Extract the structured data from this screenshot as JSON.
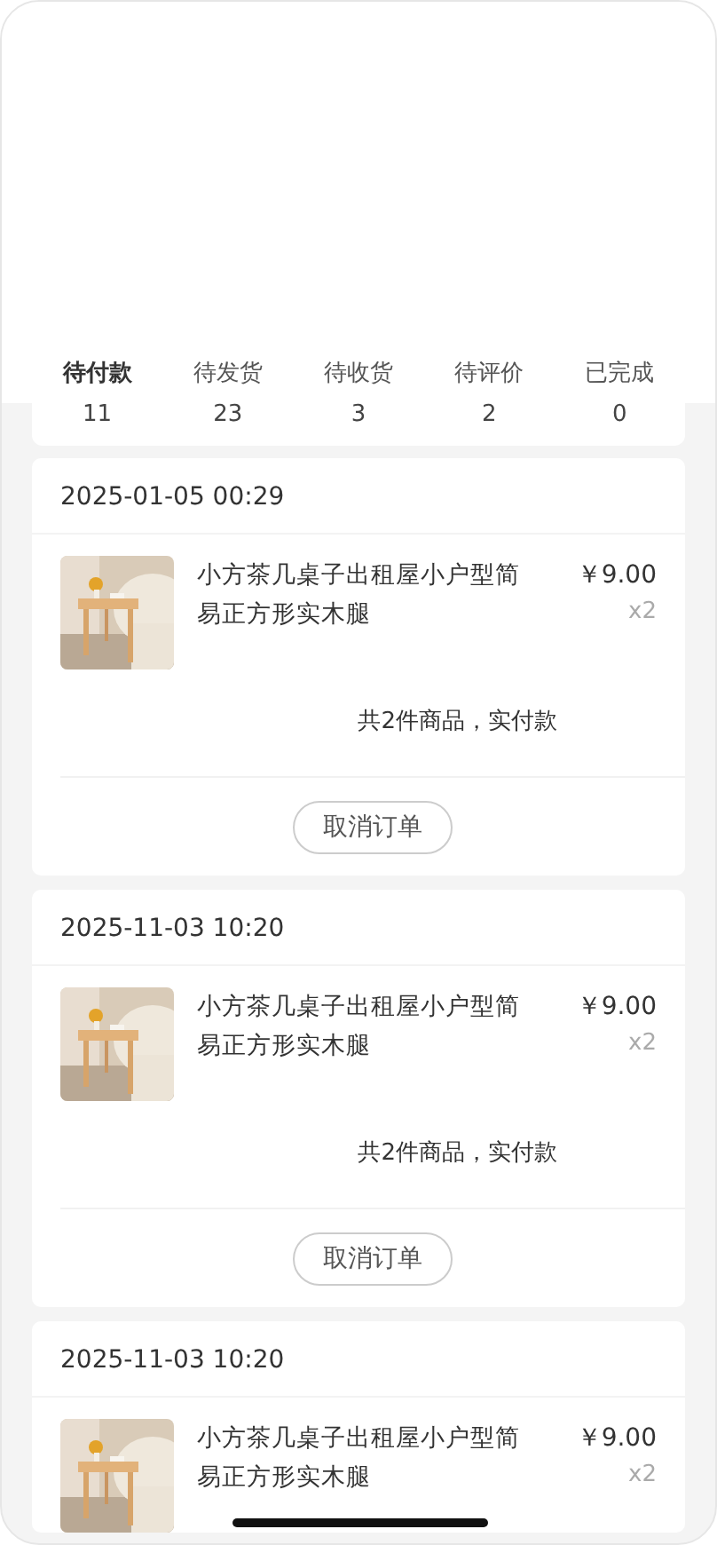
{
  "tabs": [
    {
      "label": "待付款",
      "count": "11",
      "selected": true
    },
    {
      "label": "待发货",
      "count": "23",
      "selected": false
    },
    {
      "label": "待收货",
      "count": "3",
      "selected": false
    },
    {
      "label": "待评价",
      "count": "2",
      "selected": false
    },
    {
      "label": "已完成",
      "count": "0",
      "selected": false
    }
  ],
  "orders": [
    {
      "time": "2025-01-05 00:29",
      "items": [
        {
          "title": "小方茶几桌子出租屋小户型简易正方形实木腿",
          "price": "￥9.00",
          "quantity": "x2"
        }
      ],
      "summary": "共2件商品，实付款",
      "action": "取消订单"
    },
    {
      "time": "2025-11-03 10:20",
      "items": [
        {
          "title": "小方茶几桌子出租屋小户型简易正方形实木腿",
          "price": "￥9.00",
          "quantity": "x2"
        }
      ],
      "summary": "共2件商品，实付款",
      "action": "取消订单"
    },
    {
      "time": "2025-11-03 10:20",
      "items": [
        {
          "title": "小方茶几桌子出租屋小户型简易正方形实木腿",
          "price": "￥9.00",
          "quantity": "x2"
        }
      ]
    }
  ]
}
